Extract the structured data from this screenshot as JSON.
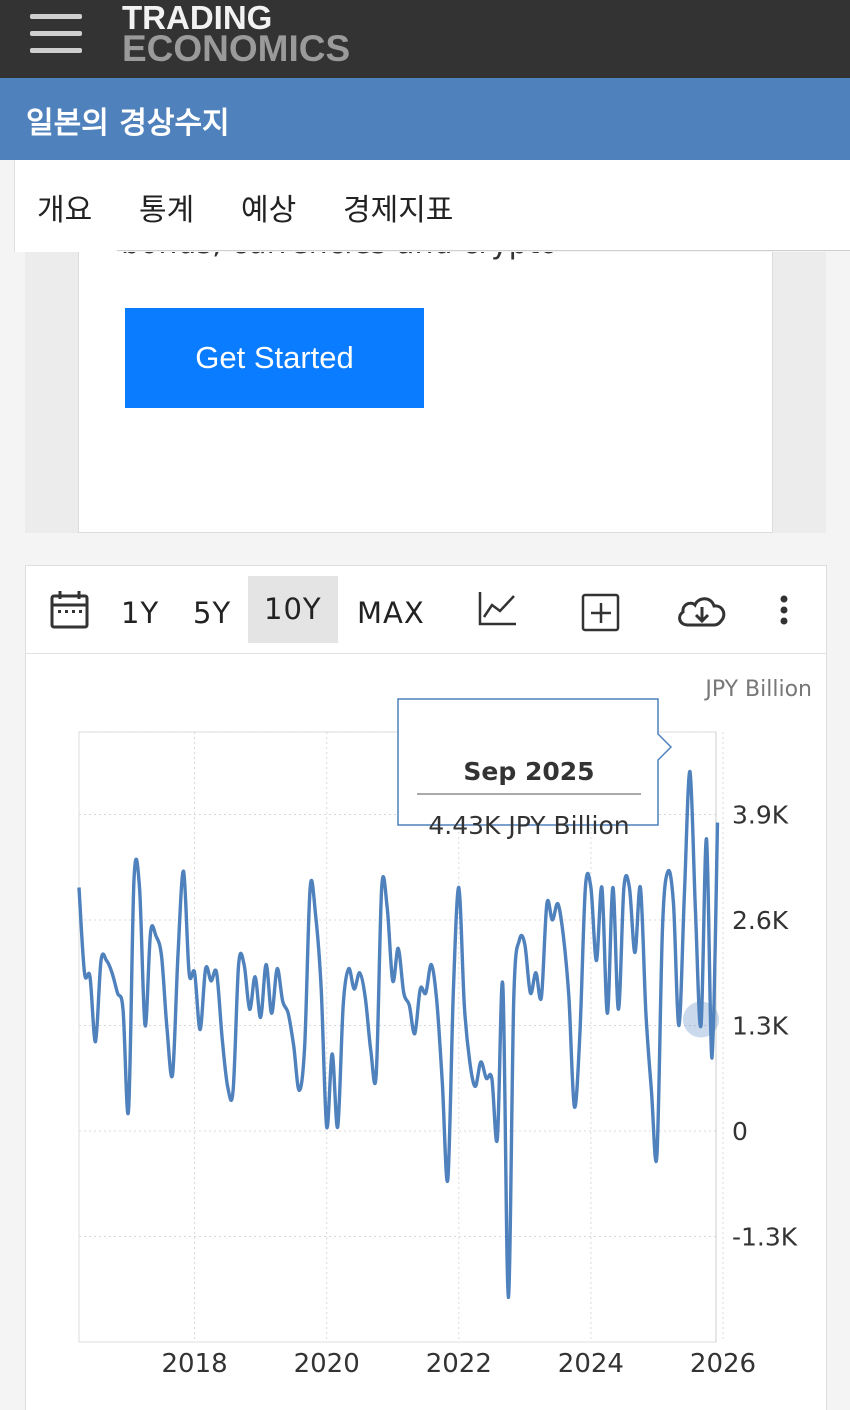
{
  "header": {
    "logo_line1": "TRADING",
    "logo_line2": "ECONOMICS"
  },
  "page_title": "일본의 경상수지",
  "tabs": [
    "개요",
    "통계",
    "예상",
    "경제지표"
  ],
  "promo": {
    "cut_text": "bonds, currencies and crypto",
    "button_label": "Get Started"
  },
  "toolbar": {
    "ranges": [
      "1Y",
      "5Y",
      "10Y",
      "MAX"
    ],
    "selected_range": "10Y",
    "icons": [
      "calendar-icon",
      "line-chart-icon",
      "add-compare-icon",
      "download-icon",
      "more-vert-icon"
    ]
  },
  "tooltip": {
    "date": "Sep 2025",
    "value": "4.43K JPY Billion"
  },
  "colors": {
    "line": "#4f81bd",
    "header_bg": "#333333",
    "title_bg": "#4f81bd",
    "button_bg": "#0a7cff"
  },
  "chart_data": {
    "type": "line",
    "unit_label": "JPY Billion",
    "xlabel": "",
    "ylabel": "",
    "x_ticks": [
      "2018",
      "2020",
      "2022",
      "2024",
      "2026"
    ],
    "y_ticks": [
      "3.9K",
      "2.6K",
      "1.3K",
      "0",
      "-1.3K"
    ],
    "xlim": [
      "2016-04",
      "2026-01"
    ],
    "ylim": [
      -2600,
      4900
    ],
    "grid": true,
    "series": [
      {
        "x": [
          "2016-04",
          "2016-05",
          "2016-06",
          "2016-07",
          "2016-08",
          "2016-09",
          "2016-10",
          "2016-11",
          "2016-12",
          "2017-01",
          "2017-02",
          "2017-03",
          "2017-04",
          "2017-05",
          "2017-06",
          "2017-07",
          "2017-08",
          "2017-09",
          "2017-10",
          "2017-11",
          "2017-12",
          "2018-01",
          "2018-02",
          "2018-03",
          "2018-04",
          "2018-05",
          "2018-06",
          "2018-07",
          "2018-08",
          "2018-09",
          "2018-10",
          "2018-11",
          "2018-12",
          "2019-01",
          "2019-02",
          "2019-03",
          "2019-04",
          "2019-05",
          "2019-06",
          "2019-07",
          "2019-08",
          "2019-09",
          "2019-10",
          "2019-11",
          "2019-12",
          "2020-01",
          "2020-02",
          "2020-03",
          "2020-04",
          "2020-05",
          "2020-06",
          "2020-07",
          "2020-08",
          "2020-09",
          "2020-10",
          "2020-11",
          "2020-12",
          "2021-01",
          "2021-02",
          "2021-03",
          "2021-04",
          "2021-05",
          "2021-06",
          "2021-07",
          "2021-08",
          "2021-09",
          "2021-10",
          "2021-11",
          "2021-12",
          "2022-01",
          "2022-02",
          "2022-03",
          "2022-04",
          "2022-05",
          "2022-06",
          "2022-07",
          "2022-08",
          "2022-09",
          "2022-10",
          "2022-11",
          "2022-12",
          "2023-01",
          "2023-02",
          "2023-03",
          "2023-04",
          "2023-05",
          "2023-06",
          "2023-07",
          "2023-08",
          "2023-09",
          "2023-10",
          "2023-11",
          "2023-12",
          "2024-01",
          "2024-02",
          "2024-03",
          "2024-04",
          "2024-05",
          "2024-06",
          "2024-07",
          "2024-08",
          "2024-09",
          "2024-10",
          "2024-11",
          "2024-12",
          "2025-01",
          "2025-02",
          "2025-03",
          "2025-04",
          "2025-05",
          "2025-06",
          "2025-07",
          "2025-08",
          "2025-09",
          "2025-10",
          "2025-11",
          "2025-12"
        ],
        "values": [
          3000,
          1950,
          1900,
          1100,
          2100,
          2100,
          1950,
          1700,
          1500,
          250,
          3100,
          3000,
          1300,
          2450,
          2400,
          2150,
          1250,
          700,
          2200,
          3200,
          1950,
          1950,
          1250,
          2000,
          1850,
          1950,
          1150,
          550,
          500,
          2050,
          2050,
          1500,
          1900,
          1400,
          2050,
          1450,
          2000,
          1600,
          1450,
          1050,
          500,
          1050,
          3000,
          2650,
          1750,
          50,
          950,
          50,
          1550,
          2000,
          1750,
          1950,
          1650,
          1000,
          700,
          3000,
          2750,
          1850,
          2250,
          1700,
          1550,
          1200,
          1750,
          1700,
          2050,
          1600,
          600,
          -600,
          1700,
          3000,
          1550,
          850,
          550,
          850,
          650,
          650,
          -100,
          1800,
          -2050,
          1650,
          2350,
          2300,
          1700,
          1950,
          1650,
          2800,
          2600,
          2800,
          2400,
          1650,
          300,
          1200,
          3000,
          3000,
          2100,
          3000,
          1450,
          3000,
          1500,
          3000,
          3000,
          2200,
          3000,
          1450,
          500,
          -300,
          2500,
          3200,
          2800,
          1300,
          2950,
          4430,
          2700,
          1300,
          3600,
          900,
          3800
        ]
      }
    ]
  }
}
